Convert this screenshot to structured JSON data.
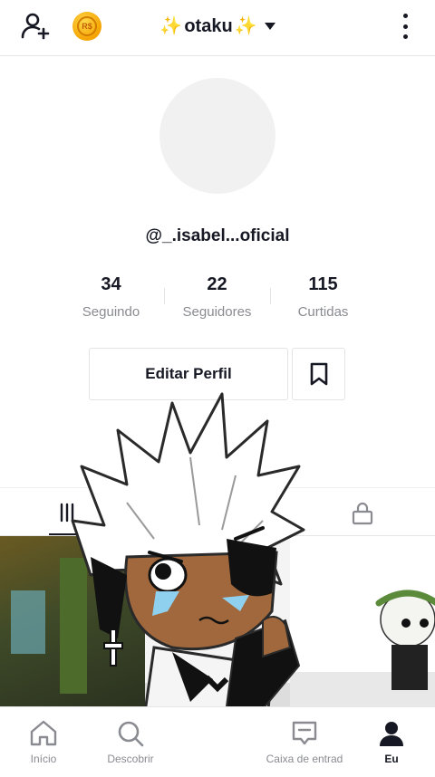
{
  "header": {
    "title": "otaku",
    "sparkle_left": "✨",
    "sparkle_right": "✨",
    "coin_label": "R$",
    "icons": [
      "add-user-icon",
      "coin-icon",
      "caret-down-icon",
      "more-vertical-icon"
    ]
  },
  "profile": {
    "username": "@_.isabel...oficial",
    "stats": [
      {
        "value": "34",
        "label": "Seguindo"
      },
      {
        "value": "22",
        "label": "Seguidores"
      },
      {
        "value": "115",
        "label": "Curtidas"
      }
    ],
    "edit_button": "Editar Perfil"
  },
  "tabs": {
    "icons": [
      "videos-grid-icon",
      "lock-icon"
    ]
  },
  "nav": {
    "items": [
      {
        "label": "Início",
        "icon": "home-icon"
      },
      {
        "label": "Descobrir",
        "icon": "search-icon"
      },
      {
        "label": "",
        "icon": "create-icon"
      },
      {
        "label": "Caixa de entrad",
        "icon": "inbox-icon"
      },
      {
        "label": "Eu",
        "icon": "profile-icon"
      }
    ]
  },
  "colors": {
    "text": "#161823",
    "muted": "#8a8b91",
    "coin": "#f5a300",
    "sparkle": "#f2c81c"
  }
}
